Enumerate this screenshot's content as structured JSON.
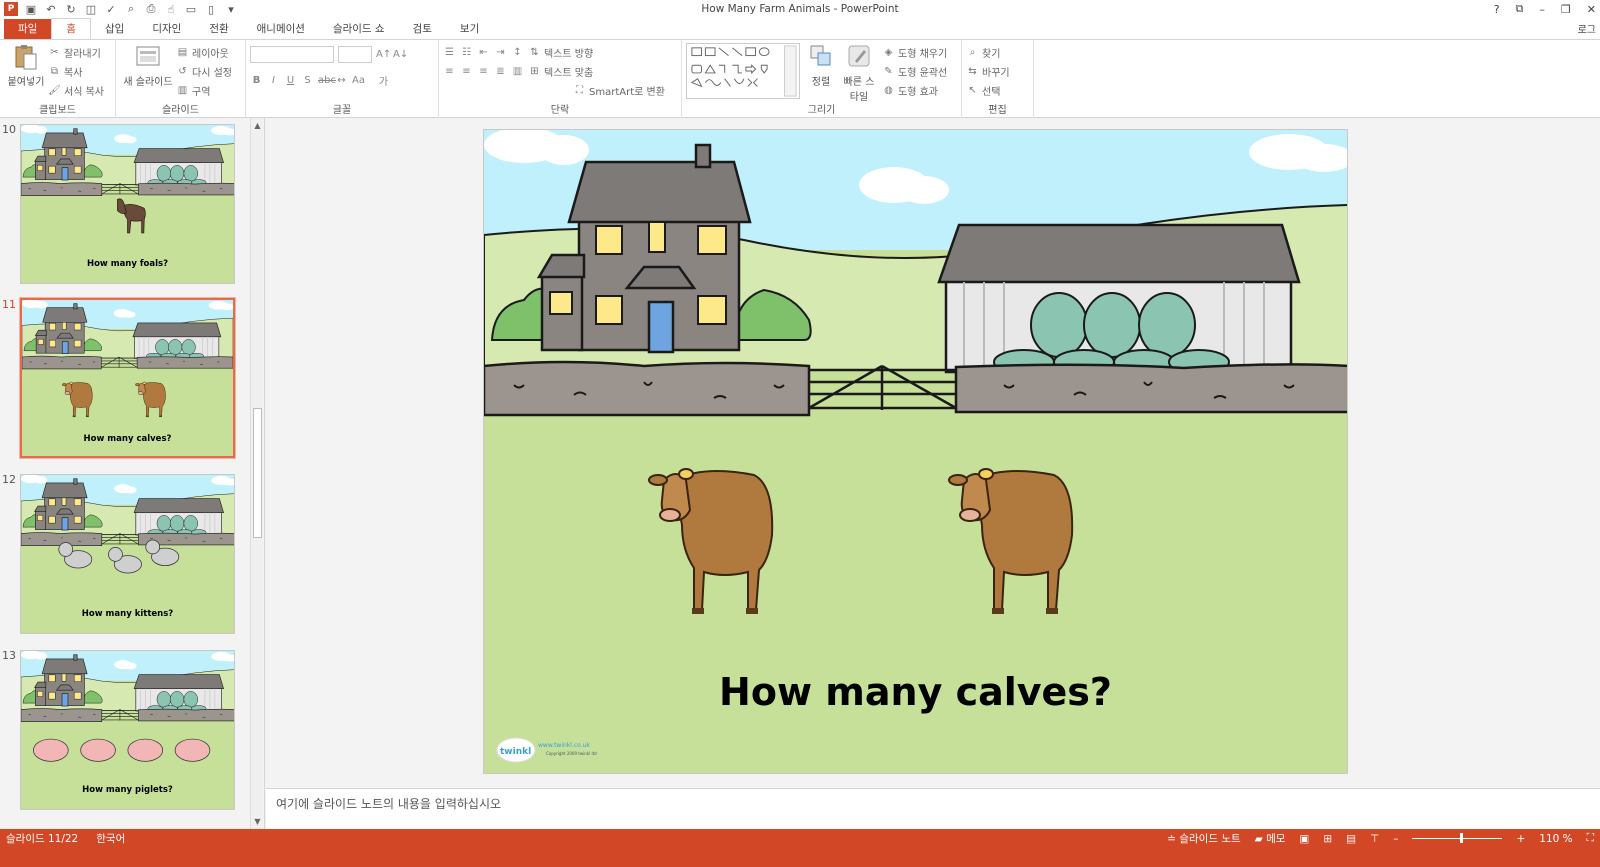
{
  "window": {
    "title": "How Many Farm Animals - PowerPoint",
    "help": "?",
    "signin": "로그"
  },
  "qat": [
    "save-icon",
    "undo-icon",
    "redo-icon",
    "start-presentation-icon",
    "spelling-icon",
    "preview-icon",
    "print-icon",
    "touch-mode-icon",
    "open-icon",
    "new-icon",
    "customize-icon"
  ],
  "tabs": [
    {
      "label": "파일"
    },
    {
      "label": "홈"
    },
    {
      "label": "삽입"
    },
    {
      "label": "디자인"
    },
    {
      "label": "전환"
    },
    {
      "label": "애니메이션"
    },
    {
      "label": "슬라이드 쇼"
    },
    {
      "label": "검토"
    },
    {
      "label": "보기"
    }
  ],
  "ribbon": {
    "clipboard": {
      "paste": "붙여넣기",
      "cut": "잘라내기",
      "copy": "복사",
      "format_painter": "서식 복사",
      "label": "클립보드"
    },
    "slides": {
      "new_slide": "새 슬라이드",
      "layout": "레이아웃",
      "reset": "다시 설정",
      "section": "구역",
      "label": "슬라이드"
    },
    "font": {
      "label": "글꼴",
      "case": "Aa",
      "clear": "가"
    },
    "paragraph": {
      "text_direction": "텍스트 방향",
      "align_text": "텍스트 맞춤",
      "smartart": "SmartArt로 변환",
      "label": "단락"
    },
    "drawing": {
      "arrange": "정렬",
      "quick_styles": "빠른 스타일",
      "shape_fill": "도형 채우기",
      "shape_outline": "도형 윤곽선",
      "shape_effects": "도형 효과",
      "label": "그리기"
    },
    "editing": {
      "find": "찾기",
      "replace": "바꾸기",
      "select": "선택",
      "label": "편집"
    }
  },
  "thumbnails": [
    {
      "number": "10",
      "caption": "How many foals?"
    },
    {
      "number": "11",
      "caption": "How many calves?"
    },
    {
      "number": "12",
      "caption": "How many kittens?"
    },
    {
      "number": "13",
      "caption": "How many piglets?"
    }
  ],
  "slide": {
    "title": "How many calves?",
    "logo_text": "twinkl",
    "url": "www.twinkl.co.uk",
    "copyright": "Copyright 2009 twinkl ltd"
  },
  "notes": {
    "placeholder": "여기에 슬라이드 노트의 내용을 입력하십시오"
  },
  "status": {
    "slide": "슬라이드 11/22",
    "language": "한국어",
    "notes": "슬라이드 노트",
    "comments": "메모",
    "zoom": "110 %"
  },
  "colors": {
    "accent": "#d24726",
    "sky": "#bff0fb",
    "grass": "#c6e09a",
    "hill": "#d6e9b1"
  }
}
